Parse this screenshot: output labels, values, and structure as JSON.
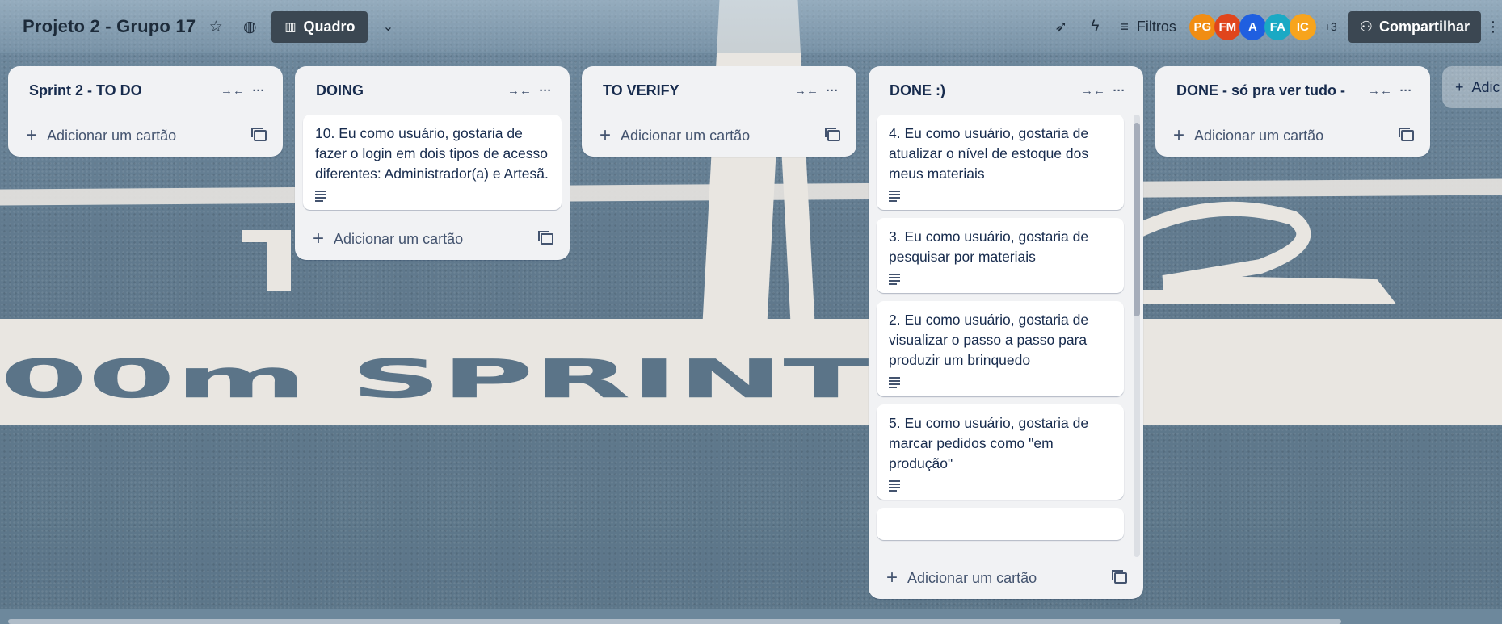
{
  "board": {
    "title": "Projeto 2 - Grupo 17",
    "view_label": "Quadro",
    "filters_label": "Filtros",
    "share_label": "Compartilhar",
    "members_more": "+3",
    "members": [
      {
        "initials": "PG",
        "color": "#f18d13"
      },
      {
        "initials": "FM",
        "color": "#e0451c"
      },
      {
        "initials": "A",
        "color": "#1f5fe0"
      },
      {
        "initials": "FA",
        "color": "#1aa9c4"
      },
      {
        "initials": "IC",
        "color": "#f7a41d"
      }
    ]
  },
  "background_text": "00m SPRINT",
  "lists": [
    {
      "title": "Sprint 2 - TO DO",
      "add_label": "Adicionar um cartão",
      "cards": []
    },
    {
      "title": "DOING",
      "add_label": "Adicionar um cartão",
      "cards": [
        {
          "text": "10. Eu como usuário, gostaria de fazer o login em dois tipos de acesso diferentes: Administrador(a) e Artesã."
        }
      ]
    },
    {
      "title": "TO VERIFY",
      "add_label": "Adicionar um cartão",
      "cards": []
    },
    {
      "title": "DONE :)",
      "add_label": "Adicionar um cartão",
      "cards": [
        {
          "text": "4. Eu como usuário, gostaria de atualizar o nível de estoque dos meus materiais"
        },
        {
          "text": "3. Eu como usuário, gostaria de pesquisar por materiais"
        },
        {
          "text": "2. Eu como usuário, gostaria de visualizar o passo a passo para produzir um brinquedo"
        },
        {
          "text": "5. Eu como usuário, gostaria de marcar pedidos como \"em produção\""
        }
      ]
    },
    {
      "title": "DONE - só pra ver tudo -",
      "add_label": "Adicionar um cartão",
      "cards": []
    }
  ],
  "add_list_label": "Adic"
}
